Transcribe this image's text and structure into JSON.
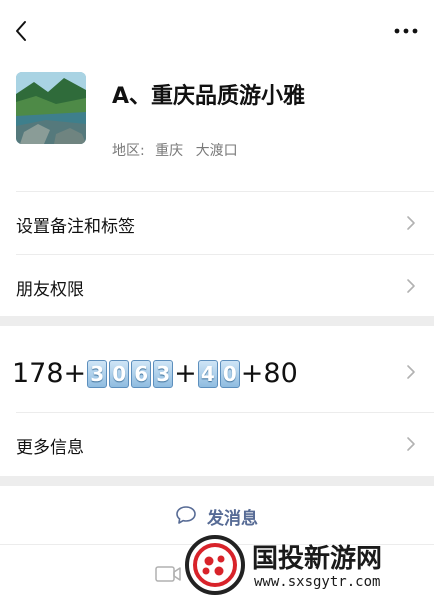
{
  "header": {
    "back_icon": "chevron-left-icon",
    "more_icon": "ellipsis-icon"
  },
  "profile": {
    "name": "A、重庆品质游小雅",
    "region_label": "地区:",
    "region_city": "重庆",
    "region_district": "大渡口"
  },
  "rows": {
    "remark": "设置备注和标签",
    "moments": "朋友权限",
    "more_info": "更多信息"
  },
  "phone": {
    "prefix": "178+",
    "boxed_a": [
      "3",
      "0",
      "6",
      "3"
    ],
    "mid": "+",
    "boxed_b": [
      "4",
      "0"
    ],
    "suffix": "+80"
  },
  "actions": {
    "send_message": "发消息",
    "send_icon": "chat-bubble-icon",
    "video_icon": "video-camera-icon"
  },
  "watermark": {
    "name": "国投新游网",
    "url": "www.sxsgytr.com"
  },
  "colors": {
    "link_blue": "#576b95",
    "keycap_blue": "#8fbce0",
    "separator": "#ededed"
  }
}
